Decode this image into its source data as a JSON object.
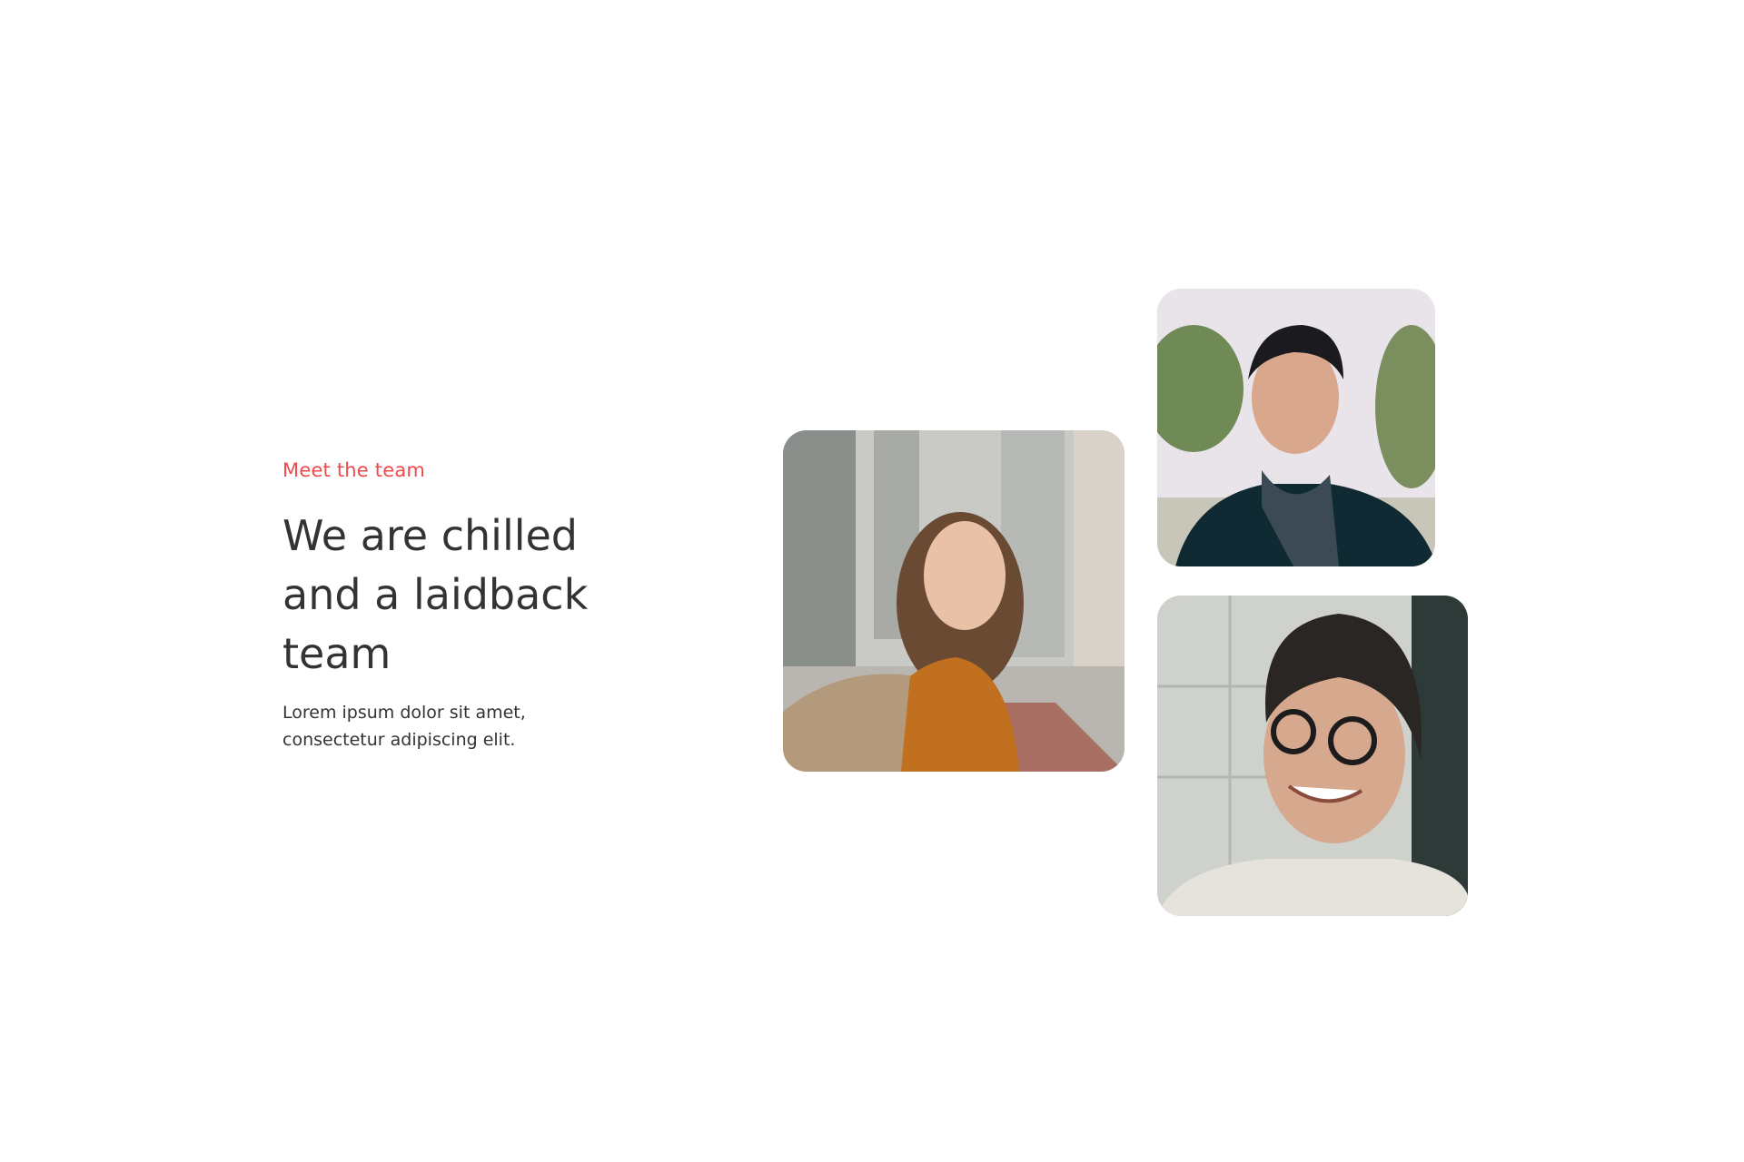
{
  "section": {
    "eyebrow": "Meet the team",
    "title": "We are chilled and a laidback team",
    "description": "Lorem ipsum dolor sit amet, consectetur adipiscing elit."
  },
  "colors": {
    "accent": "#ef4b4b",
    "text": "#333333"
  },
  "photos": [
    {
      "subject": "smiling-woman-city-street"
    },
    {
      "subject": "smiling-man-scarf"
    },
    {
      "subject": "smiling-man-glasses"
    }
  ]
}
